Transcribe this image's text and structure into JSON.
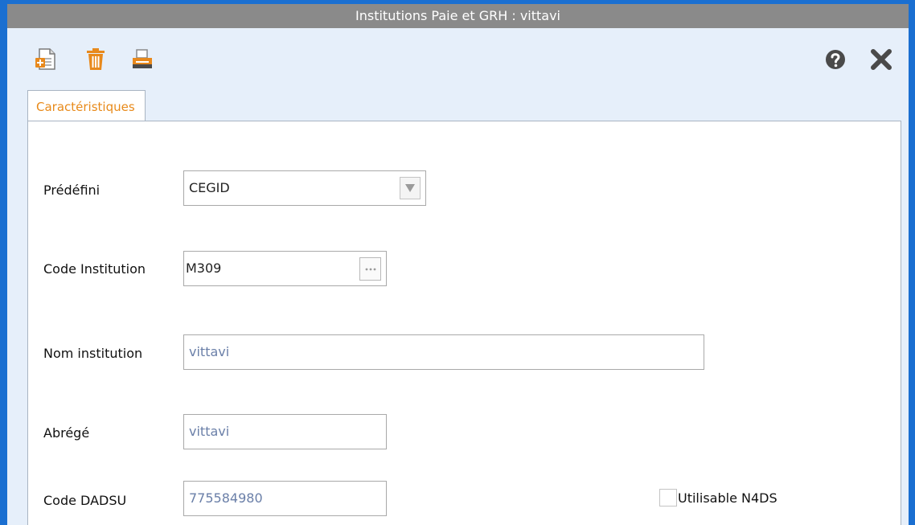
{
  "window": {
    "title": "Institutions Paie et GRH : vittavi"
  },
  "toolbar": {
    "left_icons": [
      "new-document-icon",
      "delete-trash-icon",
      "print-icon"
    ],
    "right_icons": [
      "help-icon",
      "close-icon"
    ]
  },
  "tabs": [
    {
      "label": "Caractéristiques",
      "active": true
    }
  ],
  "form": {
    "predefini": {
      "label": "Prédéfini",
      "value": "CEGID"
    },
    "code_institution": {
      "label": "Code Institution",
      "value": "M309"
    },
    "nom_institution": {
      "label": "Nom institution",
      "value": "vittavi"
    },
    "abrege": {
      "label": "Abrégé",
      "value": "vittavi"
    },
    "code_dadsu": {
      "label": "Code DADSU",
      "value": "775584980"
    },
    "utilisable_n4ds": {
      "label": "Utilisable N4DS",
      "checked": false
    }
  },
  "colors": {
    "frame": "#1a6fd1",
    "titlebar": "#8a8a8a",
    "tab_text": "#e88a1a",
    "readonly_text": "#6a7fa8",
    "toolbar_icon": "#e8891c"
  }
}
